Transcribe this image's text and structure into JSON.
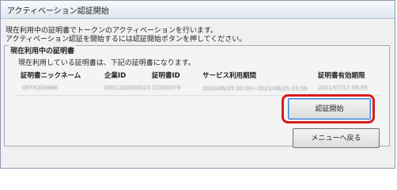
{
  "window": {
    "title": "アクティベーション認証開始"
  },
  "description": {
    "line1": "現在利用中の証明書でトークンのアクティベーションを行います。",
    "line2": "アクティベーション認証を開始するには認証開始ボタンを押してください。"
  },
  "certificate_group": {
    "title": "現在利用中の証明書",
    "description": "現在利用している証明書は、下記の証明書になります。",
    "columns": [
      {
        "header": "証明書ニックネーム",
        "value": "OFFICE0AWK"
      },
      {
        "header": "企業ID",
        "value": "0001202000023"
      },
      {
        "header": "証明書ID",
        "value": "CC000079"
      },
      {
        "header": "サービス利用期間",
        "value": "2020/06/25 00:00～2021/06/25 23:59"
      },
      {
        "header": "証明書有効期限",
        "value": "2021/07/17 09:59"
      }
    ]
  },
  "buttons": {
    "start_auth": "認証開始",
    "back_to_menu": "メニューへ戻る"
  },
  "highlight_color": "#d81e1e"
}
